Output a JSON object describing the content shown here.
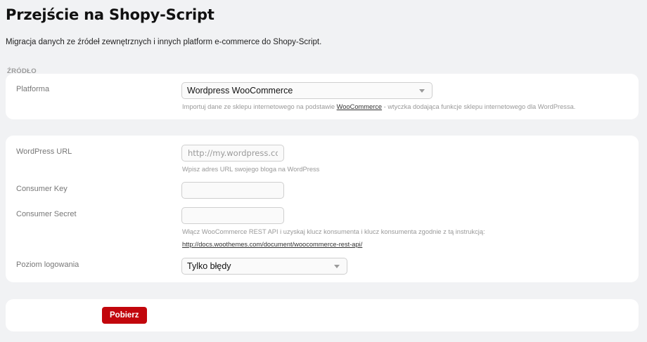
{
  "page": {
    "title": "Przejście na Shopy-Script",
    "subtitle": "Migracja danych ze źródeł zewnętrznych i innych platform e-commerce do Shopy-Script."
  },
  "source": {
    "section_label": "ŹRÓDŁO",
    "platform_label": "Platforma",
    "platform_value": "Wordpress WooCommerce",
    "platform_hint_before": "Importuj dane ze sklepu internetowego na podstawie ",
    "platform_hint_link": "WooCommerce",
    "platform_hint_after": " - wtyczka dodająca funkcje sklepu internetowego dla WordPressa."
  },
  "settings": {
    "url_label": "WordPress URL",
    "url_placeholder": "http://my.wordpress.com",
    "url_hint": "Wpisz adres URL swojego bloga na WordPress",
    "key_label": "Consumer Key",
    "key_value": "",
    "secret_label": "Consumer Secret",
    "secret_value": "",
    "secret_hint": "Włącz WooCommerce REST API i uzyskaj klucz konsumenta i klucz konsumenta zgodnie z tą instrukcją:",
    "secret_link": "http://docs.woothemes.com/document/woocommerce-rest-api/",
    "log_label": "Poziom logowania",
    "log_value": "Tylko błędy"
  },
  "actions": {
    "submit_label": "Pobierz"
  },
  "colors": {
    "primary_button": "#c2060c",
    "background": "#f1f2f4",
    "card": "#ffffff"
  }
}
